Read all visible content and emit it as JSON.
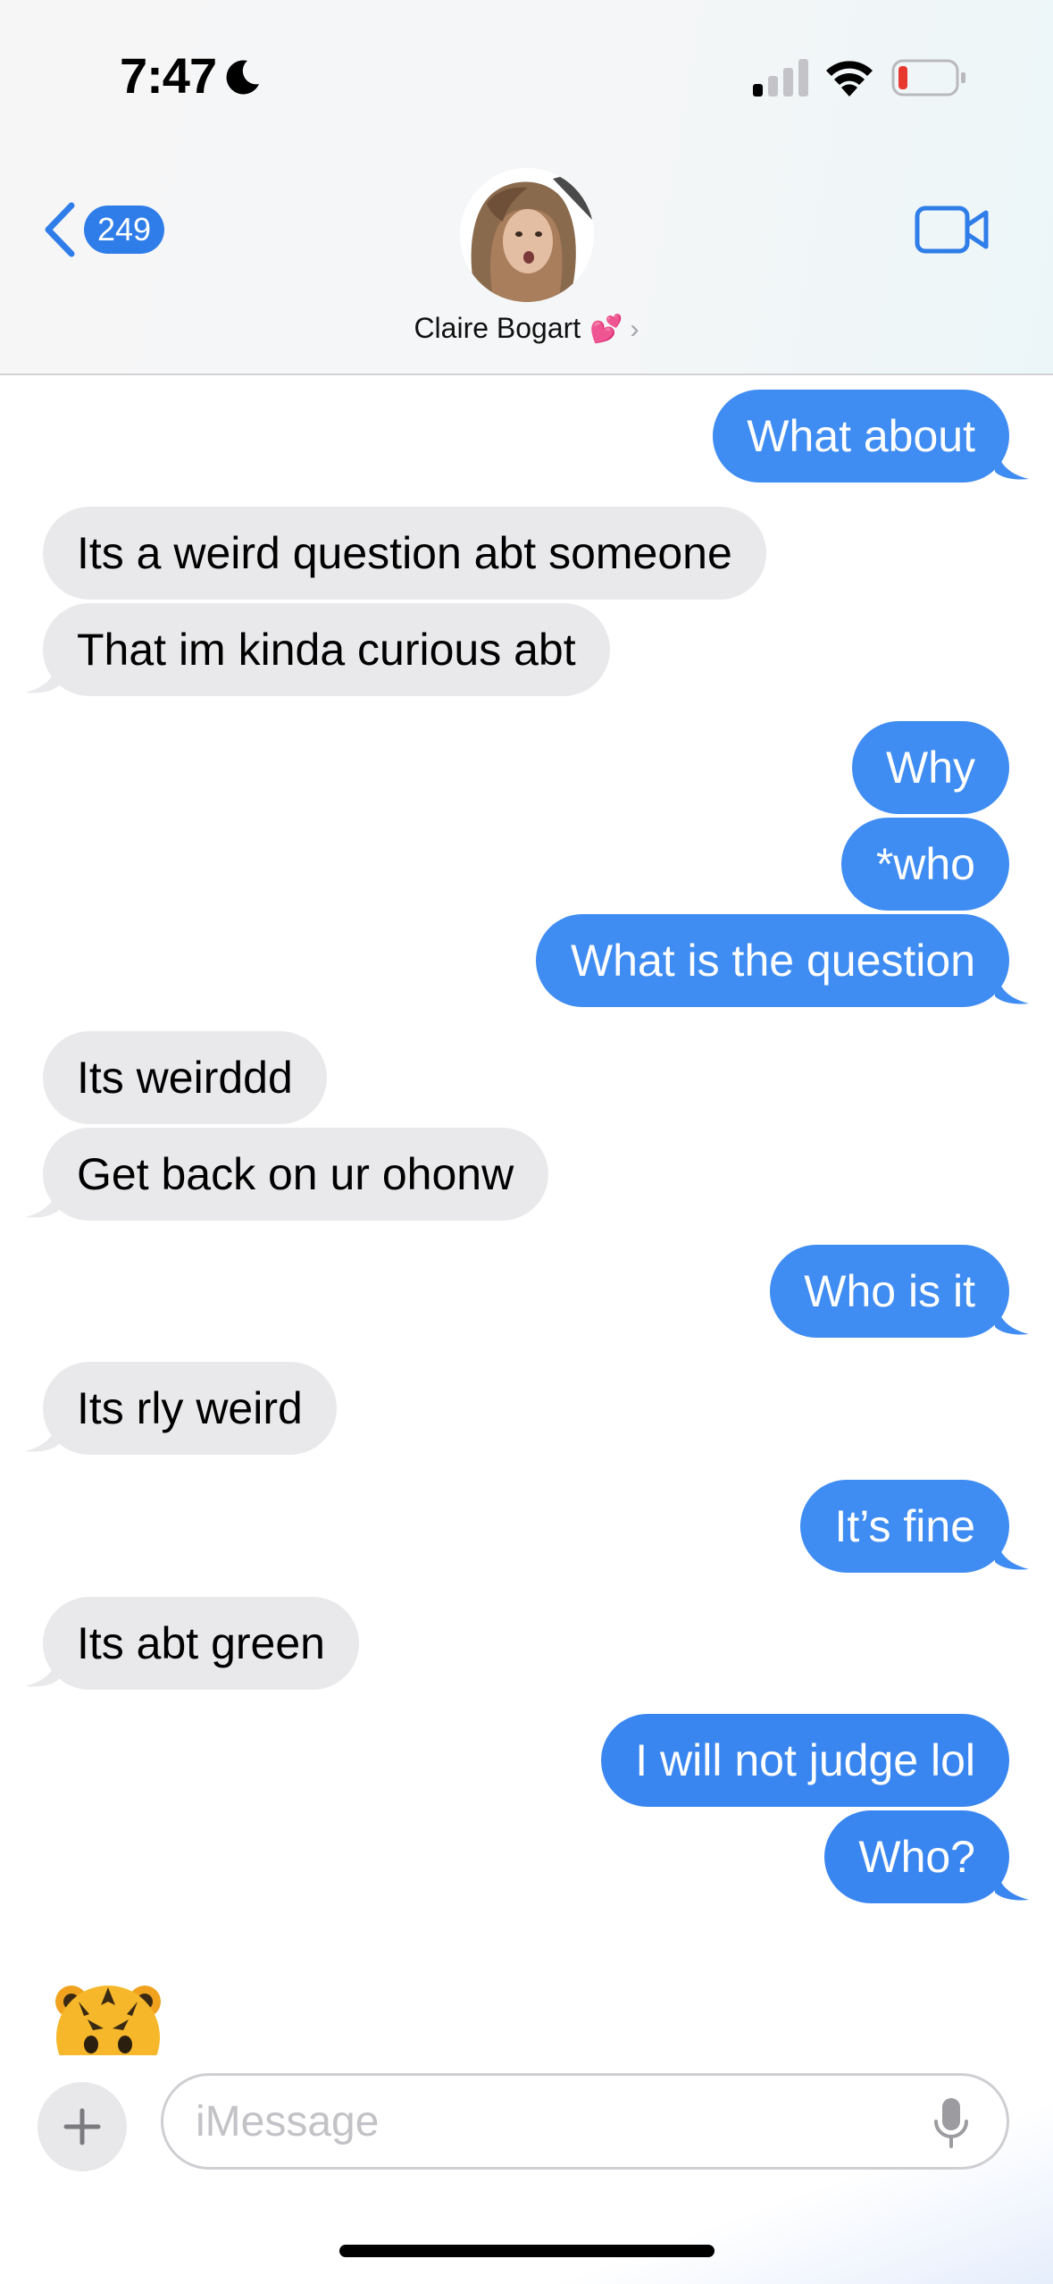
{
  "status_bar": {
    "time": "7:47",
    "icons": [
      "moon-icon",
      "signal-icon",
      "wifi-icon",
      "battery-low-icon"
    ],
    "battery_color": "#e8382d"
  },
  "header": {
    "back_count": "249",
    "contact_name": "Claire Bogart",
    "contact_emoji": "💕",
    "chevron": "›",
    "accent_color": "#2f7de9"
  },
  "messages": [
    {
      "from": "me",
      "text": "What about"
    },
    {
      "from": "them",
      "text": "Its a weird question abt someone"
    },
    {
      "from": "them",
      "text": "That im kinda curious abt"
    },
    {
      "from": "me",
      "text": "Why"
    },
    {
      "from": "me",
      "text": "*who"
    },
    {
      "from": "me",
      "text": "What is the question"
    },
    {
      "from": "them",
      "text": "Its weirddd"
    },
    {
      "from": "them",
      "text": "Get back on ur ohonw"
    },
    {
      "from": "me",
      "text": "Who is it"
    },
    {
      "from": "them",
      "text": "Its rly weird"
    },
    {
      "from": "me",
      "text": "It’s fine"
    },
    {
      "from": "them",
      "text": "Its abt green"
    },
    {
      "from": "me",
      "text": "I will not judge lol"
    },
    {
      "from": "me",
      "text": "Who?"
    }
  ],
  "typing_indicator": {
    "icon": "tiger-face-icon"
  },
  "composer": {
    "placeholder": "iMessage",
    "value": ""
  },
  "colors": {
    "sent_bubble": "#3f8cf2",
    "received_bubble": "#e9e9eb"
  }
}
